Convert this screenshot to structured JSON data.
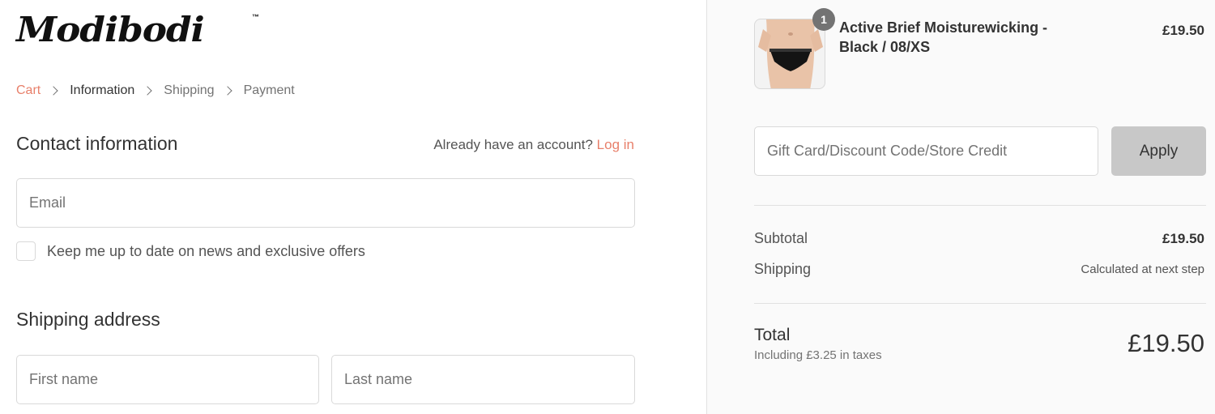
{
  "brand": {
    "logo_text": "Modibodi",
    "trademark": "™"
  },
  "breadcrumb": {
    "items": [
      "Cart",
      "Information",
      "Shipping",
      "Payment"
    ]
  },
  "contact": {
    "title": "Contact information",
    "account_prompt": "Already have an account?",
    "login_link": "Log in",
    "email_placeholder": "Email",
    "newsletter_label": "Keep me up to date on news and exclusive offers"
  },
  "shipping_address": {
    "title": "Shipping address",
    "first_name_placeholder": "First name",
    "last_name_placeholder": "Last name"
  },
  "order": {
    "item": {
      "quantity": "1",
      "name": "Active Brief Moisturewicking - Black / 08/XS",
      "price": "£19.50"
    },
    "discount_placeholder": "Gift Card/Discount Code/Store Credit",
    "apply_label": "Apply",
    "subtotal_label": "Subtotal",
    "subtotal_value": "£19.50",
    "shipping_label": "Shipping",
    "shipping_value": "Calculated at next step",
    "total_label": "Total",
    "total_taxes": "Including £3.25 in taxes",
    "total_value": "£19.50"
  },
  "colors": {
    "accent": "#e8806b",
    "sidebar_bg": "#fafafa",
    "apply_bg": "#c8c8c8"
  }
}
